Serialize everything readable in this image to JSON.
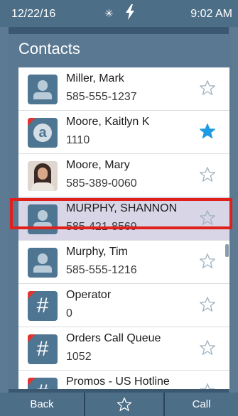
{
  "status_bar": {
    "date": "12/22/16",
    "bluetooth_icon": "bluetooth-icon",
    "power_icon": "lightning-bolt-icon",
    "time": "9:02 AM"
  },
  "dialog": {
    "title": "Contacts"
  },
  "contacts": [
    {
      "name": "Miller, Mark",
      "number": "585-555-1237",
      "avatar": "person-icon",
      "favorite": false,
      "flag": false
    },
    {
      "name": "Moore, Kaitlyn K",
      "number": "1110",
      "avatar": "app-a-icon",
      "favorite": true,
      "flag": true
    },
    {
      "name": "Moore, Mary",
      "number": "585-389-0060",
      "avatar": "photo",
      "favorite": false,
      "flag": false
    },
    {
      "name": "MURPHY, SHANNON",
      "number": "585-421-8569",
      "avatar": "person-icon",
      "favorite": false,
      "flag": false,
      "selected": true
    },
    {
      "name": "Murphy, Tim",
      "number": "585-555-1216",
      "avatar": "person-icon",
      "favorite": false,
      "flag": false
    },
    {
      "name": "Operator",
      "number": "0",
      "avatar": "hash-icon",
      "favorite": false,
      "flag": true
    },
    {
      "name": "Orders Call Queue",
      "number": "1052",
      "avatar": "hash-icon",
      "favorite": false,
      "flag": true
    },
    {
      "name": "Promos - US Hotline",
      "number": "",
      "avatar": "hash-icon",
      "favorite": false,
      "flag": true
    }
  ],
  "toolbar": {
    "back_label": "Back",
    "favorite_icon": "star-outline-icon",
    "call_label": "Call"
  },
  "colors": {
    "accent": "#1d9be3",
    "highlight": "#e0201a",
    "header": "#4d6e87",
    "selected_row": "#d7d5e6"
  }
}
